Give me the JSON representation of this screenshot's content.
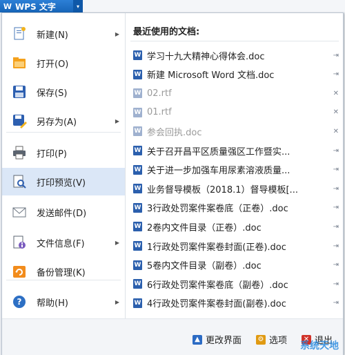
{
  "app_button": {
    "logo": "W",
    "title": "WPS 文字",
    "dropdown": "▾"
  },
  "left_menu": [
    {
      "label": "新建(N)",
      "icon": "new-doc-icon",
      "has_submenu": true
    },
    {
      "label": "打开(O)",
      "icon": "open-folder-icon",
      "has_submenu": false
    },
    {
      "label": "保存(S)",
      "icon": "save-icon",
      "has_submenu": false
    },
    {
      "label": "另存为(A)",
      "icon": "save-as-icon",
      "has_submenu": true
    },
    {
      "label": "打印(P)",
      "icon": "print-icon",
      "has_submenu": false
    },
    {
      "label": "打印预览(V)",
      "icon": "print-preview-icon",
      "has_submenu": false,
      "active": true
    },
    {
      "label": "发送邮件(D)",
      "icon": "mail-icon",
      "has_submenu": false
    },
    {
      "label": "文件信息(F)",
      "icon": "file-info-icon",
      "has_submenu": true
    },
    {
      "label": "备份管理(K)",
      "icon": "backup-icon",
      "has_submenu": false
    },
    {
      "label": "帮助(H)",
      "icon": "help-icon",
      "has_submenu": true
    }
  ],
  "recent": {
    "title": "最近使用的文档:",
    "docs": [
      {
        "name": "学习十九大精神心得体会.doc",
        "pinned": true,
        "gray": false
      },
      {
        "name": "新建 Microsoft Word 文档.doc",
        "pinned": true,
        "gray": false
      },
      {
        "name": "02.rtf",
        "pinned": false,
        "gray": true
      },
      {
        "name": "01.rtf",
        "pinned": false,
        "gray": true
      },
      {
        "name": "参会回执.doc",
        "pinned": false,
        "gray": true
      },
      {
        "name": "关于召开昌平区质量强区工作暨实...",
        "pinned": true,
        "gray": false
      },
      {
        "name": "关于进一步加强车用尿素溶液质量...",
        "pinned": true,
        "gray": false
      },
      {
        "name": "业务督导模板（2018.1）督导模板[...",
        "pinned": true,
        "gray": false
      },
      {
        "name": "3行政处罚案件案卷底（正卷）.doc",
        "pinned": true,
        "gray": false
      },
      {
        "name": "2卷内文件目录（正卷）.doc",
        "pinned": true,
        "gray": false
      },
      {
        "name": "1行政处罚案件案卷封面(正卷).doc",
        "pinned": true,
        "gray": false
      },
      {
        "name": "5卷内文件目录（副卷）.doc",
        "pinned": true,
        "gray": false
      },
      {
        "name": "6行政处罚案件案卷底（副卷）.doc",
        "pinned": true,
        "gray": false
      },
      {
        "name": "4行政处罚案件案卷封面(副卷).doc",
        "pinned": true,
        "gray": false
      }
    ]
  },
  "bottom": {
    "change_ui": "更改界面",
    "options": "选项",
    "exit": "退出"
  },
  "watermark": "系统天地",
  "colors": {
    "accent": "#1765b8",
    "active_bg": "#dbe7f7"
  }
}
